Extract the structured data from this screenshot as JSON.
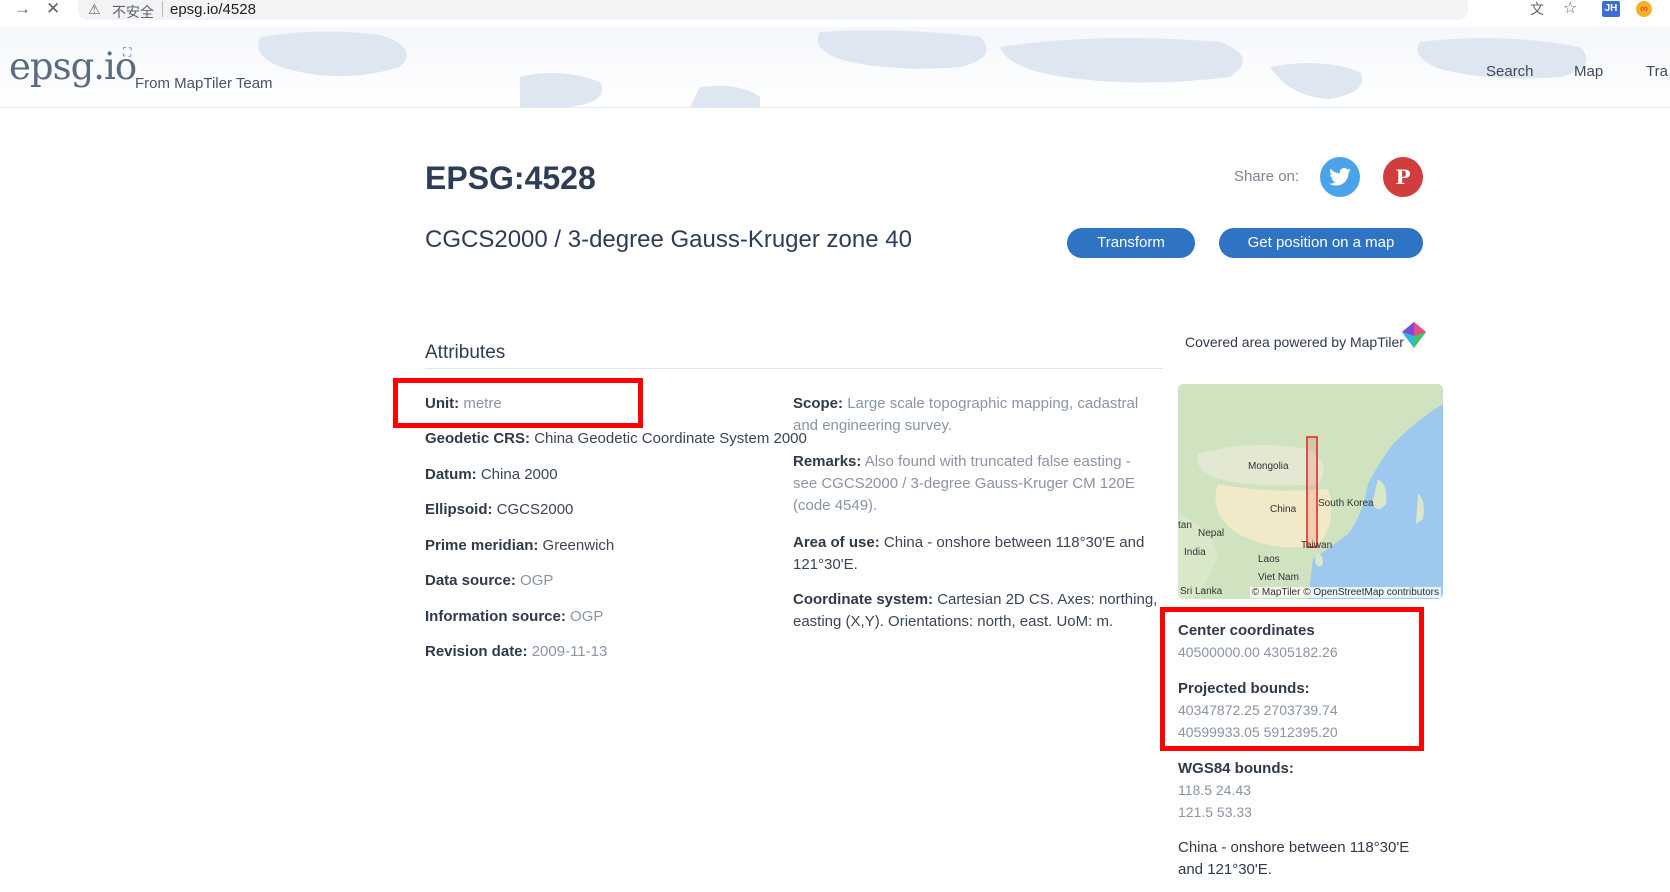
{
  "browser": {
    "security_label": "不安全",
    "url": "epsg.io/4528"
  },
  "header": {
    "logo": "epsg.io",
    "tagline": "From MapTiler Team",
    "nav": [
      "Search",
      "Map",
      "Tra"
    ]
  },
  "page": {
    "title": "EPSG:4528",
    "subtitle": "CGCS2000 / 3-degree Gauss-Kruger zone 40",
    "share_label": "Share on:",
    "transform_label": "Transform",
    "position_label": "Get position on a map",
    "section_title": "Attributes"
  },
  "attributes_left": [
    {
      "key": "Unit:",
      "value": "metre",
      "muted": true
    },
    {
      "key": "Geodetic CRS:",
      "value": "China Geodetic Coordinate System 2000",
      "muted": false
    },
    {
      "key": "Datum:",
      "value": "China 2000",
      "muted": false
    },
    {
      "key": "Ellipsoid:",
      "value": "CGCS2000",
      "muted": false
    },
    {
      "key": "Prime meridian:",
      "value": "Greenwich",
      "muted": false
    },
    {
      "key": "Data source:",
      "value": "OGP",
      "muted": true
    },
    {
      "key": "Information source:",
      "value": "OGP",
      "muted": true
    },
    {
      "key": "Revision date:",
      "value": "2009-11-13",
      "muted": true
    }
  ],
  "attributes_right": [
    {
      "key": "Scope:",
      "value": "Large scale topographic mapping, cadastral and engineering survey.",
      "muted": true
    },
    {
      "key": "Remarks:",
      "value": "Also found with truncated false easting - see CGCS2000 / 3-degree Gauss-Kruger CM 120E (code 4549).",
      "muted": true
    },
    {
      "key": "Area of use:",
      "value": "China - onshore between 118°30'E and 121°30'E.",
      "muted": false
    },
    {
      "key": "Coordinate system:",
      "value": "Cartesian 2D CS. Axes: northing, easting (X,Y). Orientations: north, east. UoM: m.",
      "muted": false
    }
  ],
  "sidebar": {
    "covered_label": "Covered area powered by MapTiler",
    "map_labels": [
      "Mongolia",
      "China",
      "South Korea",
      "Nepal",
      "India",
      "Laos",
      "Taiwan",
      "Viet Nam",
      "Sri Lanka",
      "tan"
    ],
    "map_attribution": "© MapTiler © OpenStreetMap contributors",
    "center_label": "Center coordinates",
    "center_value": "40500000.00 4305182.26",
    "projected_label": "Projected bounds:",
    "projected_1": "40347872.25 2703739.74",
    "projected_2": "40599933.05 5912395.20",
    "wgs_label": "WGS84 bounds:",
    "wgs_1": "118.5 24.43",
    "wgs_2": "121.5 53.33",
    "area_text": "China - onshore between 118°30'E and 121°30'E."
  }
}
